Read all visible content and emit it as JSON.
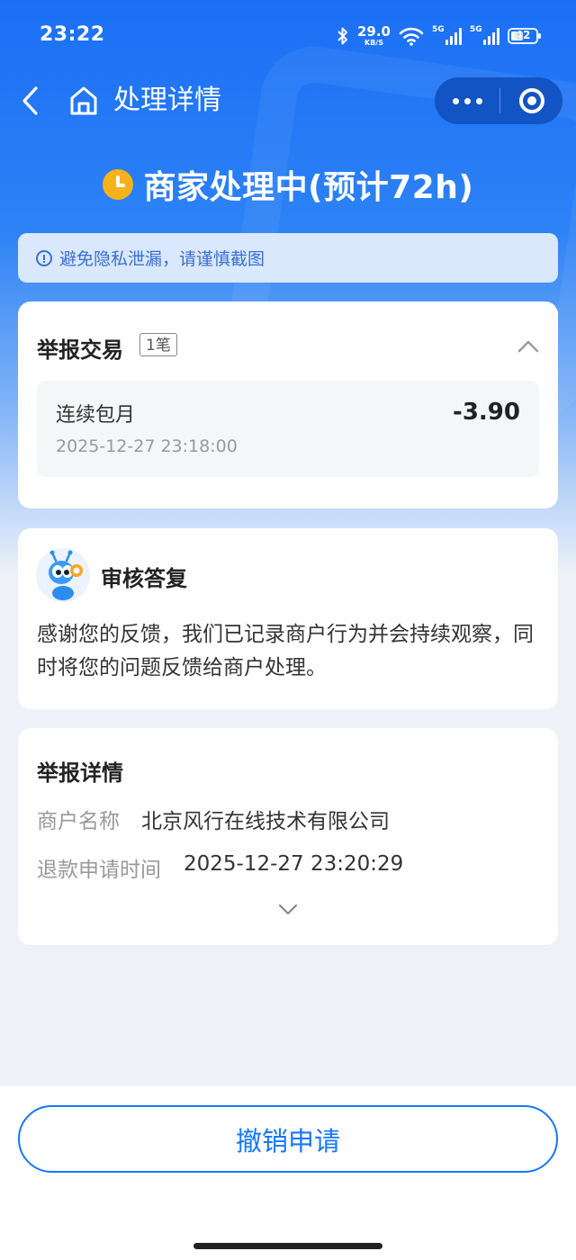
{
  "status_bar": {
    "time": "23:22",
    "net_speed_value": "29.0",
    "net_speed_unit": "KB/S",
    "signal1_label": "5G",
    "signal2_label": "5G",
    "battery": "42"
  },
  "nav": {
    "title": "处理详情"
  },
  "status": {
    "headline": "商家处理中(预计72h)"
  },
  "notice": {
    "text": "避免隐私泄漏，请谨慎截图"
  },
  "report_transaction": {
    "title": "举报交易",
    "count_badge": "1笔",
    "items": [
      {
        "name": "连续包月",
        "amount": "-3.90",
        "time": "2025-12-27 23:18:00"
      }
    ]
  },
  "review_reply": {
    "title": "审核答复",
    "body": "感谢您的反馈，我们已记录商户行为并会持续观察，同时将您的问题反馈给商户处理。"
  },
  "report_details": {
    "title": "举报详情",
    "rows": [
      {
        "label": "商户名称",
        "value": "北京风行在线技术有限公司"
      },
      {
        "label": "退款申请时间",
        "value": "2025-12-27 23:20:29"
      }
    ]
  },
  "footer": {
    "revoke_label": "撤销申请"
  },
  "colors": {
    "primary": "#1677ff",
    "header_blue": "#1b6ff5",
    "warning": "#f7b21b"
  },
  "icons": [
    "back-arrow-icon",
    "home-icon",
    "more-icon",
    "close-target-icon",
    "clock-icon",
    "info-icon",
    "chevron-up-icon",
    "chevron-down-icon",
    "robot-avatar-icon"
  ]
}
